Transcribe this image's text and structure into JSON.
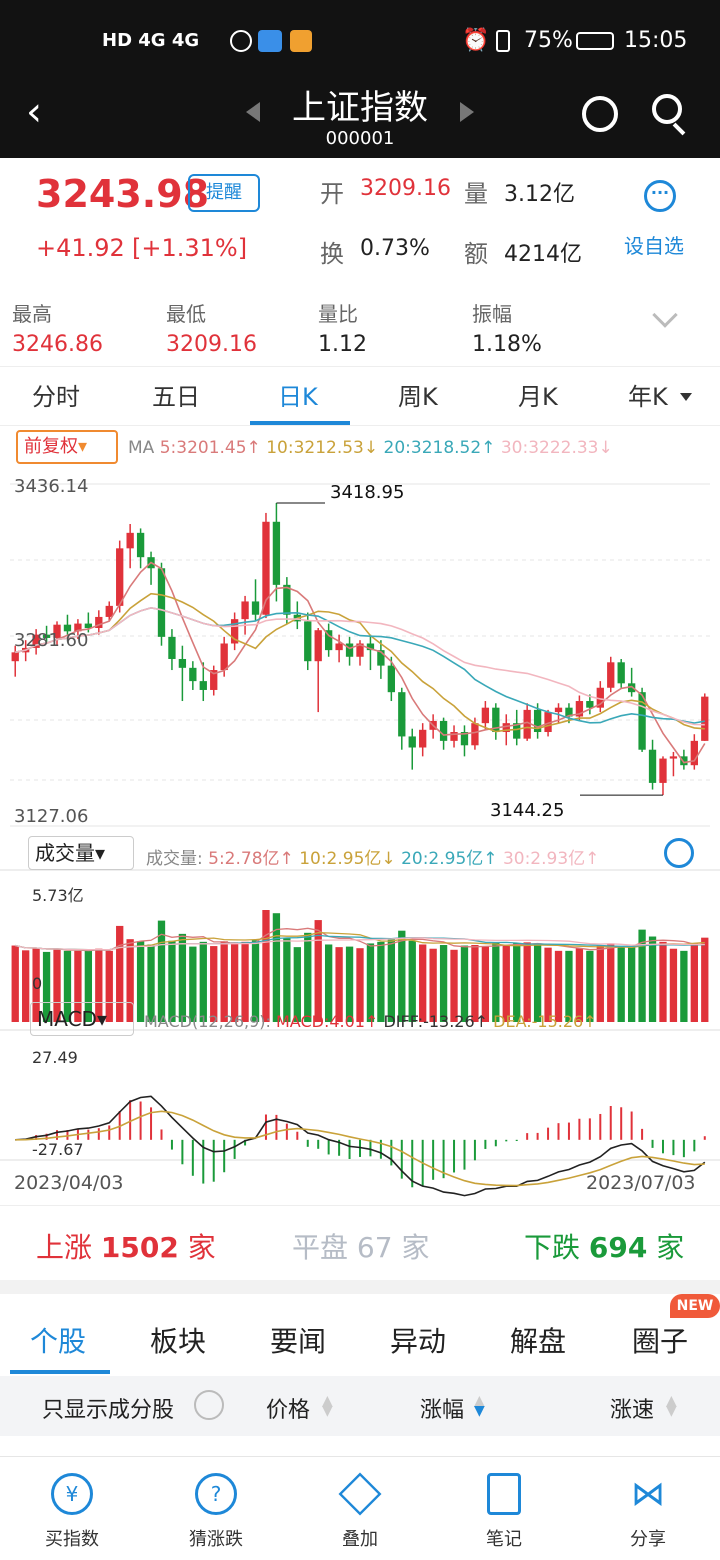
{
  "status": {
    "left_icons": "HD 4G 4G",
    "battery": "75%",
    "time": "15:05"
  },
  "nav": {
    "title": "上证指数",
    "code": "000001"
  },
  "quote": {
    "price": "3243.98",
    "remind": "提醒",
    "change": "+41.92",
    "change_pct": "[+1.31%]",
    "open_label": "开",
    "open": "3209.16",
    "vol_label": "量",
    "vol": "3.12亿",
    "turn_label": "换",
    "turn": "0.73%",
    "amt_label": "额",
    "amt": "4214亿",
    "watch": "设自选",
    "high_label": "最高",
    "high": "3246.86",
    "low_label": "最低",
    "low": "3209.16",
    "vr_label": "量比",
    "vr": "1.12",
    "amp_label": "振幅",
    "amp": "1.18%"
  },
  "tabs": [
    "分时",
    "五日",
    "日K",
    "周K",
    "月K",
    "年K"
  ],
  "active_tab": "日K",
  "ma_bar": {
    "adj": "前复权",
    "ma": "MA",
    "ma5": "5:3201.45↑",
    "ma10": "10:3212.53↓",
    "ma20": "20:3218.52↑",
    "ma30": "30:3222.33↓"
  },
  "kline": {
    "top": "3436.14",
    "mid": "3281.60",
    "bottom": "3127.06",
    "max_label": "3418.95",
    "min_label": "3144.25"
  },
  "volume": {
    "btn": "成交量",
    "label": "成交量:",
    "v5": "5:2.78亿↑",
    "v10": "10:2.95亿↓",
    "v20": "20:2.95亿↑",
    "v30": "30:2.93亿↑",
    "top": "5.73亿",
    "zero": "0"
  },
  "macd": {
    "btn": "MACD",
    "params": "MACD(12,26,9):",
    "macd": "MACD:4.01↑",
    "diff": "DIFF:-13.26↑",
    "dea": "DEA:-15.26↑",
    "top": "27.49",
    "bottom": "-27.67"
  },
  "dates": {
    "start": "2023/04/03",
    "end": "2023/07/03"
  },
  "breadth": {
    "up_label": "上涨",
    "up": "1502",
    "flat_label": "平盘",
    "flat": "67",
    "down_label": "下跌",
    "down": "694",
    "unit": "家"
  },
  "news_tabs": [
    "个股",
    "板块",
    "要闻",
    "异动",
    "解盘",
    "圈子"
  ],
  "new_badge": "NEW",
  "filter": {
    "only": "只显示成分股",
    "price": "价格",
    "pct": "涨幅",
    "speed": "涨速"
  },
  "bottom_nav": [
    "买指数",
    "猜涨跌",
    "叠加",
    "笔记",
    "分享"
  ],
  "colors": {
    "up": "#e0323a",
    "down": "#1a9a3a",
    "accent": "#1e88d8",
    "ma5": "#d97a7a",
    "ma10": "#c9a23a",
    "ma20": "#3aa8b8",
    "ma30": "#f2b6bf"
  },
  "chart_data": {
    "type": "candlestick",
    "x_range": [
      "2023/04/03",
      "2023/07/03"
    ],
    "ylim": [
      3127.06,
      3436.14
    ],
    "ohlc": [
      [
        3276,
        3290,
        3262,
        3284
      ],
      [
        3284,
        3295,
        3276,
        3288
      ],
      [
        3288,
        3305,
        3282,
        3300
      ],
      [
        3300,
        3308,
        3292,
        3297
      ],
      [
        3297,
        3312,
        3290,
        3309
      ],
      [
        3309,
        3318,
        3300,
        3303
      ],
      [
        3303,
        3314,
        3296,
        3310
      ],
      [
        3310,
        3320,
        3302,
        3306
      ],
      [
        3306,
        3322,
        3300,
        3316
      ],
      [
        3316,
        3330,
        3312,
        3326
      ],
      [
        3326,
        3385,
        3320,
        3378
      ],
      [
        3378,
        3400,
        3360,
        3392
      ],
      [
        3392,
        3396,
        3360,
        3370
      ],
      [
        3370,
        3375,
        3345,
        3360
      ],
      [
        3360,
        3365,
        3290,
        3298
      ],
      [
        3298,
        3305,
        3268,
        3278
      ],
      [
        3278,
        3290,
        3240,
        3270
      ],
      [
        3270,
        3276,
        3250,
        3258
      ],
      [
        3258,
        3275,
        3240,
        3250
      ],
      [
        3250,
        3272,
        3245,
        3268
      ],
      [
        3268,
        3298,
        3262,
        3292
      ],
      [
        3292,
        3320,
        3286,
        3314
      ],
      [
        3314,
        3335,
        3300,
        3330
      ],
      [
        3330,
        3350,
        3312,
        3318
      ],
      [
        3318,
        3410,
        3315,
        3402
      ],
      [
        3402,
        3418.95,
        3330,
        3345
      ],
      [
        3345,
        3352,
        3310,
        3318
      ],
      [
        3318,
        3330,
        3305,
        3312
      ],
      [
        3312,
        3320,
        3268,
        3276
      ],
      [
        3276,
        3306,
        3230,
        3304
      ],
      [
        3304,
        3310,
        3280,
        3286
      ],
      [
        3286,
        3300,
        3275,
        3292
      ],
      [
        3292,
        3298,
        3272,
        3280
      ],
      [
        3280,
        3295,
        3272,
        3292
      ],
      [
        3292,
        3300,
        3268,
        3286
      ],
      [
        3286,
        3295,
        3260,
        3272
      ],
      [
        3272,
        3280,
        3240,
        3248
      ],
      [
        3248,
        3252,
        3196,
        3208
      ],
      [
        3208,
        3215,
        3178,
        3198
      ],
      [
        3198,
        3220,
        3190,
        3214
      ],
      [
        3214,
        3228,
        3206,
        3222
      ],
      [
        3222,
        3225,
        3196,
        3204
      ],
      [
        3204,
        3218,
        3198,
        3212
      ],
      [
        3212,
        3218,
        3190,
        3200
      ],
      [
        3200,
        3225,
        3196,
        3220
      ],
      [
        3220,
        3240,
        3214,
        3234
      ],
      [
        3234,
        3238,
        3205,
        3212
      ],
      [
        3212,
        3228,
        3200,
        3220
      ],
      [
        3220,
        3232,
        3200,
        3206
      ],
      [
        3206,
        3238,
        3204,
        3232
      ],
      [
        3232,
        3238,
        3206,
        3212
      ],
      [
        3212,
        3232,
        3208,
        3230
      ],
      [
        3230,
        3238,
        3220,
        3234
      ],
      [
        3234,
        3238,
        3220,
        3226
      ],
      [
        3226,
        3245,
        3222,
        3240
      ],
      [
        3240,
        3246,
        3228,
        3234
      ],
      [
        3234,
        3258,
        3230,
        3252
      ],
      [
        3252,
        3280,
        3248,
        3275
      ],
      [
        3275,
        3278,
        3252,
        3256
      ],
      [
        3256,
        3270,
        3244,
        3248
      ],
      [
        3248,
        3252,
        3194,
        3196
      ],
      [
        3196,
        3205,
        3160,
        3166
      ],
      [
        3166,
        3190,
        3155,
        3188
      ],
      [
        3188,
        3194,
        3172,
        3190
      ],
      [
        3190,
        3196,
        3178,
        3182
      ],
      [
        3182,
        3210,
        3178,
        3204
      ],
      [
        3204,
        3246.86,
        3204,
        3243.98
      ]
    ],
    "volume_ylim": [
      0,
      5.73
    ],
    "macd_ylim": [
      -27.67,
      27.49
    ],
    "legend": {
      "ma5": "MA5 3201.45",
      "ma10": "MA10 3212.53",
      "ma20": "MA20 3218.52",
      "ma30": "MA30 3222.33"
    }
  }
}
